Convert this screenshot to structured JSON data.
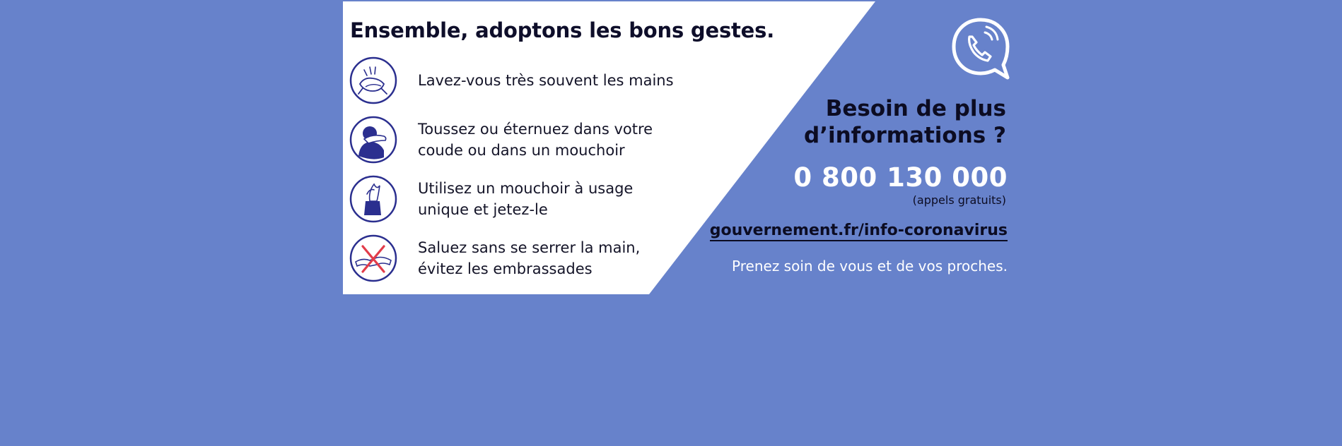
{
  "colors": {
    "page_background": "#6782cb",
    "panel_white": "#ffffff",
    "text_dark": "#0e0e2a",
    "icon_blue": "#2b2f8f",
    "cross_red": "#e23c4a"
  },
  "banner": {
    "headline": "Ensemble, adoptons les bons gestes.",
    "gestures": [
      {
        "icon": "hand-washing-icon",
        "line1": "Lavez-vous très souvent les mains",
        "line2": ""
      },
      {
        "icon": "cough-elbow-icon",
        "line1": "Toussez ou éternuez dans votre",
        "line2": "coude ou dans un mouchoir"
      },
      {
        "icon": "tissue-box-icon",
        "line1": "Utilisez un mouchoir à usage",
        "line2": "unique et jetez-le"
      },
      {
        "icon": "no-handshake-icon",
        "line1": "Saluez sans se serrer la main,",
        "line2": "évitez les embrassades"
      }
    ],
    "help": {
      "icon": "phone-speech-bubble-icon",
      "title_line1": "Besoin de plus",
      "title_line2": "d’informations ?",
      "phone_number": "0 800 130 000",
      "phone_note": "(appels gratuits)",
      "website": "gouvernement.fr/info-coronavirus",
      "closing": "Prenez soin de vous et de vos proches."
    }
  }
}
